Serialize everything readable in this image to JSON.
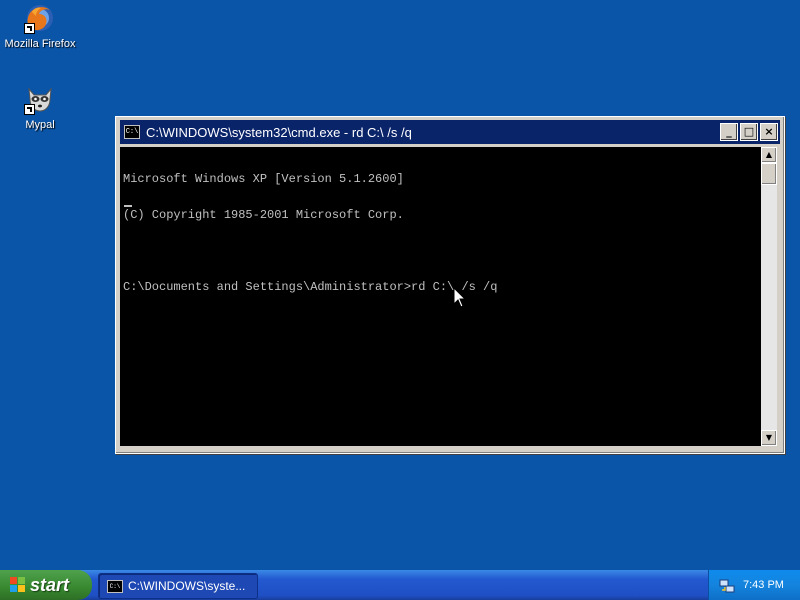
{
  "desktop": {
    "icons": [
      {
        "label": "Mozilla Firefox"
      },
      {
        "label": "Mypal"
      }
    ]
  },
  "window": {
    "title": "C:\\WINDOWS\\system32\\cmd.exe - rd C:\\ /s /q",
    "icon_glyph": "C:\\",
    "buttons": {
      "minimize": "_",
      "maximize": "□",
      "close": "×"
    },
    "console_lines": [
      "Microsoft Windows XP [Version 5.1.2600]",
      "(C) Copyright 1985-2001 Microsoft Corp.",
      "",
      "C:\\Documents and Settings\\Administrator>rd C:\\ /s /q"
    ],
    "scroll_up": "▲",
    "scroll_down": "▼"
  },
  "taskbar": {
    "start_label": "start",
    "task_label": "C:\\WINDOWS\\syste...",
    "clock": "7:43 PM"
  },
  "colors": {
    "desktop": "#0b55a8",
    "titlebar": "#0a246a",
    "console_bg": "#000000",
    "console_fg": "#c0c0c0"
  }
}
